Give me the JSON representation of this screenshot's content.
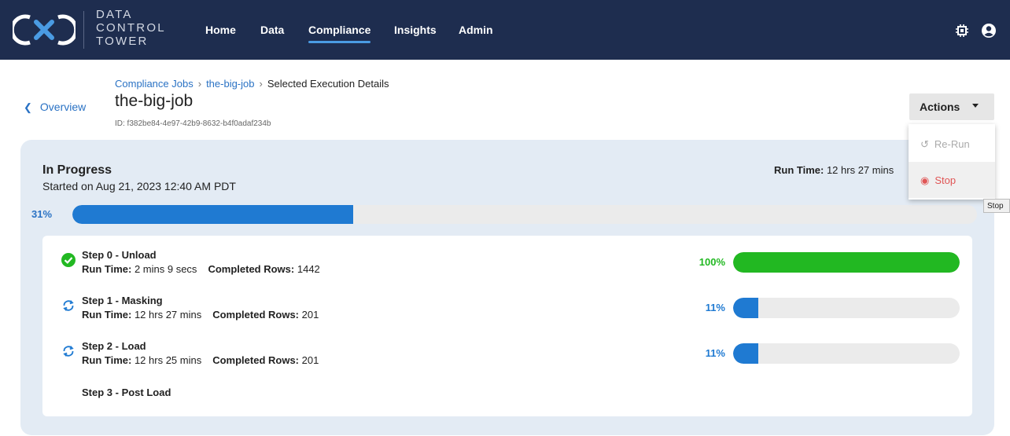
{
  "brand": {
    "logo_lines": [
      "DATA",
      "CONTROL",
      "TOWER"
    ]
  },
  "nav": {
    "items": [
      {
        "label": "Home",
        "active": false
      },
      {
        "label": "Data",
        "active": false
      },
      {
        "label": "Compliance",
        "active": true
      },
      {
        "label": "Insights",
        "active": false
      },
      {
        "label": "Admin",
        "active": false
      }
    ],
    "icons": [
      "settings-chip-icon",
      "user-account-icon"
    ]
  },
  "back_link": {
    "label": "Overview"
  },
  "breadcrumb": {
    "items": [
      "Compliance Jobs",
      "the-big-job",
      "Selected Execution Details"
    ]
  },
  "page": {
    "title": "the-big-job",
    "id_text": "ID: f382be84-4e97-42b9-8632-b4f0adaf234b"
  },
  "actions": {
    "label": "Actions",
    "menu": [
      {
        "label": "Re-Run",
        "icon": "rerun-icon",
        "enabled": false
      },
      {
        "label": "Stop",
        "icon": "stop-icon",
        "enabled": true
      }
    ],
    "tooltip": "Stop"
  },
  "execution": {
    "status": "In Progress",
    "started": "Started on Aug 21, 2023 12:40 AM PDT",
    "runtime_label": "Run Time:",
    "runtime_value": "12 hrs 27 mins",
    "progress_text": "31%",
    "progress_value": 31
  },
  "steps": [
    {
      "title": "Step 0 - Unload",
      "runtime_label": "Run Time:",
      "runtime": "2 mins 9 secs",
      "rows_label": "Completed Rows:",
      "rows": "1442",
      "pct_text": "100%",
      "pct": 100,
      "state": "complete",
      "icon": "check-circle-icon"
    },
    {
      "title": "Step 1 - Masking",
      "runtime_label": "Run Time:",
      "runtime": "12 hrs 27 mins",
      "rows_label": "Completed Rows:",
      "rows": "201",
      "pct_text": "11%",
      "pct": 11,
      "state": "running",
      "icon": "sync-icon"
    },
    {
      "title": "Step 2 - Load",
      "runtime_label": "Run Time:",
      "runtime": "12 hrs 25 mins",
      "rows_label": "Completed Rows:",
      "rows": "201",
      "pct_text": "11%",
      "pct": 11,
      "state": "running",
      "icon": "sync-icon"
    },
    {
      "title": "Step 3 - Post Load",
      "state": "pending"
    }
  ],
  "colors": {
    "nav_bg": "#1e2d4f",
    "accent_blue": "#1f7ad2",
    "success_green": "#22b822",
    "stop_red": "#e05555",
    "panel_bg": "#e3ebf4"
  }
}
